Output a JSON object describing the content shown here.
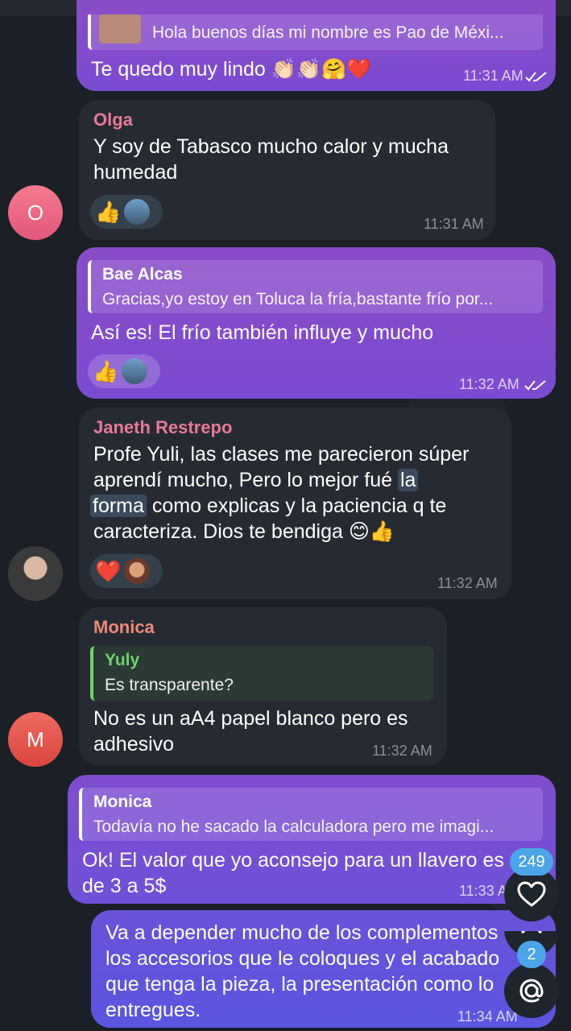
{
  "colors": {
    "background": "#1a2025",
    "incoming_bubble": "#262b33",
    "outgoing_bubble": "#8a4cc8",
    "name_pink": "#e57a98",
    "name_salmon": "#ec8a78",
    "reply_green": "#6fd36a",
    "badge_blue": "#4aa4e8"
  },
  "messages": [
    {
      "reply_text": "Hola buenos días mi nombre es Pao de Méxi...",
      "text": "Te quedo muy lindo 👏🏻👏🏻🤗❤️",
      "time": "11:31 AM"
    },
    {
      "sender": "Olga",
      "text_line1": "Y soy de Tabasco mucho calor y mucha",
      "text_line2": "humedad",
      "reaction": "👍",
      "time": "11:31 AM",
      "avatar_letter": "O"
    },
    {
      "reply_name": "Bae Alcas",
      "reply_text": "Gracias,yo estoy en Toluca la fría,bastante frío por...",
      "text": "Así es! El frío también influye y mucho",
      "reaction": "👍",
      "time": "11:32 AM"
    },
    {
      "sender": "Janeth Restrepo",
      "line1": "Profe Yuli, las clases me parecieron súper",
      "line2a": "aprendí mucho, Pero lo mejor fué ",
      "line2b": "la",
      "line3a": "forma",
      "line3b": " como explicas y la paciencia q te",
      "line4": "caracteriza. Dios te bendiga 😊👍",
      "reaction": "❤️",
      "time": "11:32 AM"
    },
    {
      "sender": "Monica",
      "reply_name": "Yuly",
      "reply_text": "Es transparente?",
      "text_line1": "No es un aA4 papel blanco pero es",
      "text_line2": "adhesivo",
      "time": "11:32 AM",
      "avatar_letter": "M"
    },
    {
      "reply_name": "Monica",
      "reply_text": "Todavía no he sacado la calculadora pero me imagi...",
      "text_line1": "Ok! El valor que yo aconsejo para un llavero es",
      "text_line2": "de 3 a 5$",
      "time": "11:33 AM"
    },
    {
      "line1": "Va a depender mucho de los complementos",
      "line2": "los accesorios que le coloques y el acabado",
      "line3": "que tenga la pieza, la presentación como lo",
      "line4": "entregues.",
      "time": "11:34 AM"
    }
  ],
  "fabs": {
    "reactions_count": "249",
    "mentions_count": "2",
    "heart_icon": "heart-icon",
    "chevron_icon": "chevron-down-icon",
    "at_icon": "at-icon"
  }
}
